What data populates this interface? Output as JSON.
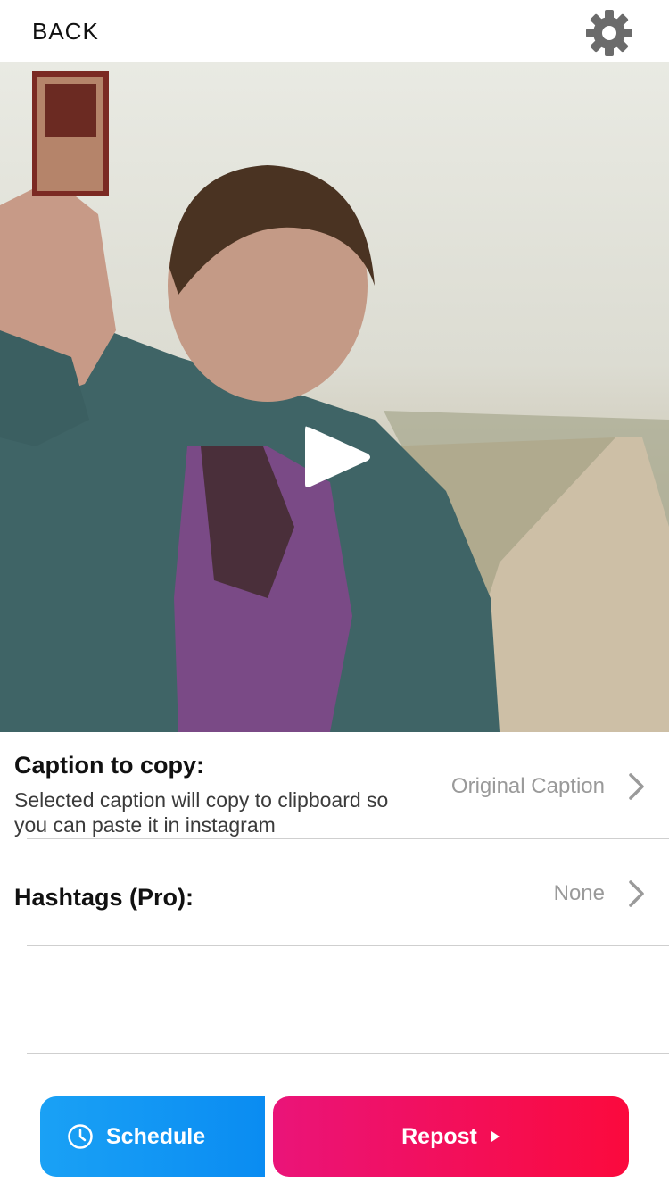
{
  "header": {
    "back_label": "BACK"
  },
  "icons": {
    "settings": "gear-icon",
    "play": "play-icon",
    "chevron": "chevron-right-icon",
    "clock": "clock-icon"
  },
  "caption": {
    "label": "Caption to copy:",
    "description": "Selected caption will copy to clipboard so you can paste it in instagram",
    "value": "Original Caption"
  },
  "hashtags": {
    "label": "Hashtags (Pro):",
    "value": "None"
  },
  "actions": {
    "schedule_label": "Schedule",
    "repost_label": "Repost"
  },
  "colors": {
    "schedule": "#0a8cf2",
    "repost_start": "#ea1479",
    "repost_end": "#fb0a3d"
  }
}
